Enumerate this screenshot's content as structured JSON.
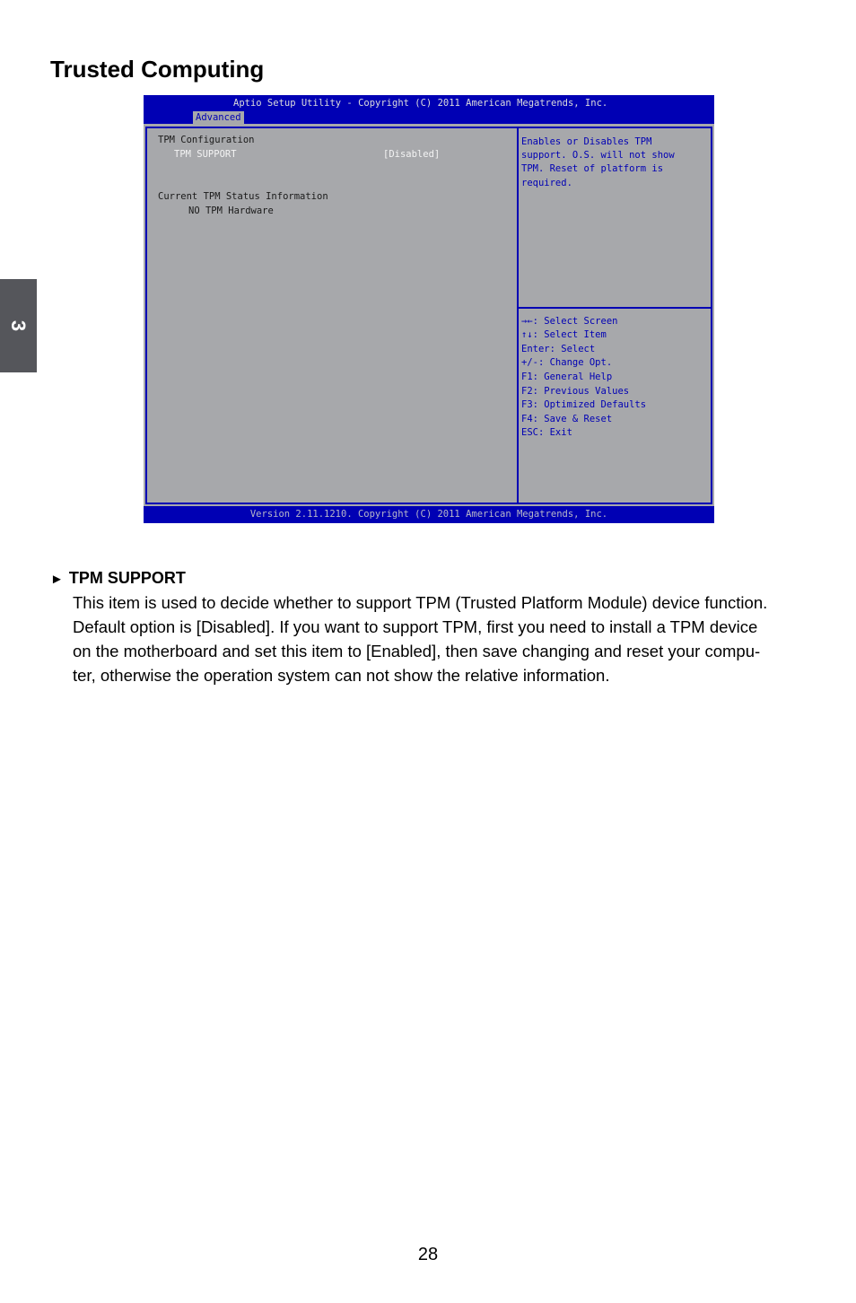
{
  "page": {
    "title": "Trusted Computing",
    "chapter_tab": "3",
    "page_number": "28"
  },
  "bios": {
    "header_title": "Aptio Setup Utility - Copyright (C) 2011 American Megatrends, Inc.",
    "active_tab": "Advanced",
    "left_panel": {
      "section1_title": "TPM Configuration",
      "item_label": "TPM SUPPORT",
      "item_value": "[Disabled]",
      "section2_title": "Current TPM Status Information",
      "status_value": "NO TPM Hardware"
    },
    "help_text": [
      "Enables or Disables TPM",
      "support. O.S. will not show",
      "TPM. Reset of platform is",
      "required."
    ],
    "key_legend": [
      "→←: Select Screen",
      "↑↓: Select Item",
      "Enter: Select",
      "+/-: Change Opt.",
      "F1: General Help",
      "F2: Previous Values",
      "F3: Optimized Defaults",
      "F4: Save & Reset",
      "ESC: Exit"
    ],
    "footer": "Version 2.11.1210. Copyright (C) 2011 American Megatrends, Inc.",
    "colors": {
      "blue": "#0000b4",
      "gray": "#a7a8ab"
    }
  },
  "description": {
    "bullet_icon": "►",
    "heading": "TPM SUPPORT",
    "lines": [
      "This item is used to decide whether to support TPM (Trusted Platform Module) device function.",
      "Default option is [Disabled]. If you want to support TPM, first you need to install a TPM device",
      "on the motherboard and set this item to [Enabled], then save changing and reset your compu-",
      "ter, otherwise the operation system can not show the relative information."
    ]
  }
}
